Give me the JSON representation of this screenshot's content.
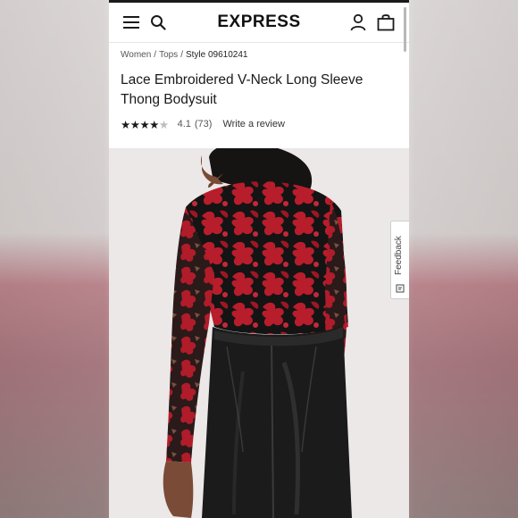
{
  "header": {
    "logo": "EXPRESS"
  },
  "breadcrumb": {
    "items": [
      "Women",
      "Tops"
    ],
    "separator": "/",
    "style": "Style 09610241"
  },
  "product": {
    "title": "Lace Embroidered V-Neck Long Sleeve Thong Bodysuit",
    "rating": {
      "stars_filled": 4,
      "stars_total": 5,
      "value": "4.1",
      "count": "(73)"
    },
    "write_review": "Write a review"
  },
  "feedback": {
    "label": "Feedback"
  },
  "colors": {
    "lace_red": "#b81d2c",
    "lace_black": "#111111",
    "leather_black": "#1b1b1b",
    "photo_bg": "#ece9e8"
  },
  "icons": [
    "menu-icon",
    "search-icon",
    "account-icon",
    "bag-icon",
    "star-icon",
    "feedback-icon"
  ]
}
